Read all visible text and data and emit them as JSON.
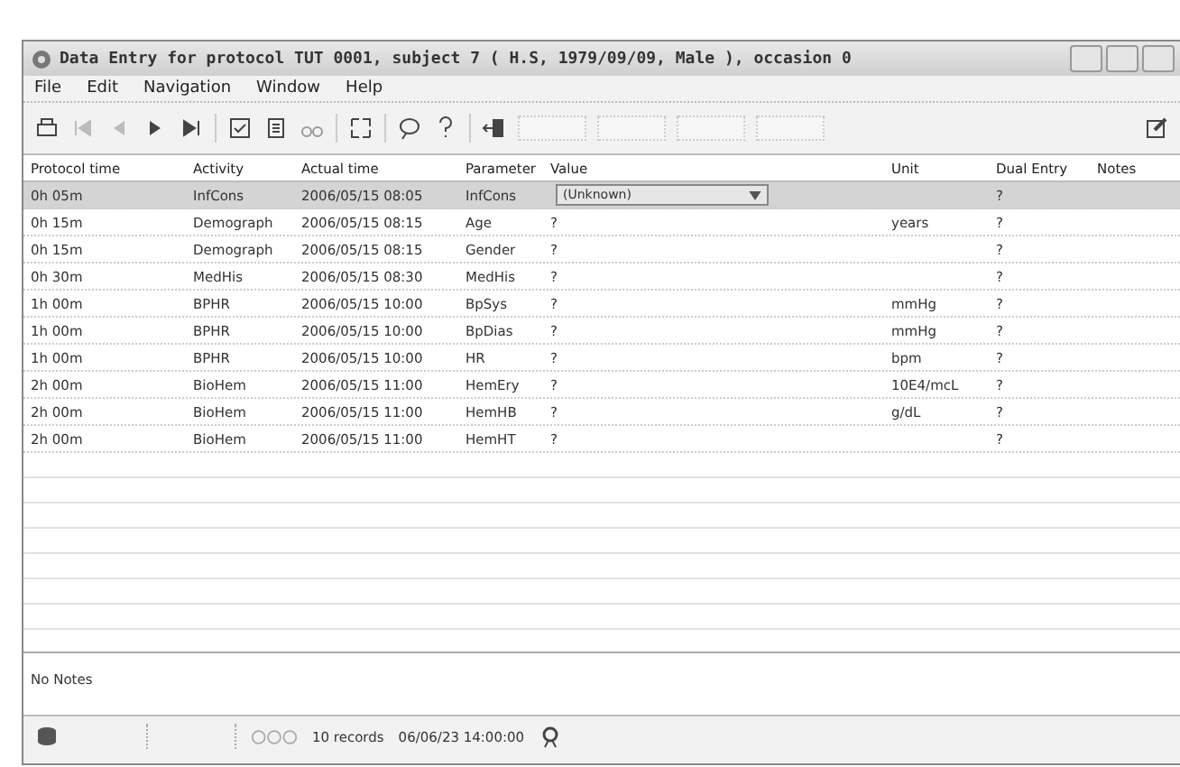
{
  "window": {
    "title": "Data Entry for protocol TUT 0001, subject 7 ( H.S, 1979/09/09, Male ), occasion 0"
  },
  "menu": [
    "File",
    "Edit",
    "Navigation",
    "Window",
    "Help"
  ],
  "table": {
    "columns": [
      "Protocol time",
      "Activity",
      "Actual time",
      "Parameter",
      "Value",
      "Unit",
      "Dual Entry",
      "Notes"
    ],
    "rows": [
      {
        "selected": true,
        "cells": [
          "0h 05m",
          "InfCons",
          "2006/05/15 08:05",
          "InfCons",
          "(Unknown)",
          "",
          "?",
          ""
        ],
        "kind": "dropdown"
      },
      {
        "selected": false,
        "cells": [
          "0h 15m",
          "Demograph",
          "2006/05/15 08:15",
          "Age",
          "?",
          "years",
          "?",
          ""
        ],
        "kind": "text"
      },
      {
        "selected": false,
        "cells": [
          "0h 15m",
          "Demograph",
          "2006/05/15 08:15",
          "Gender",
          "?",
          "",
          "?",
          ""
        ],
        "kind": "text"
      },
      {
        "selected": false,
        "cells": [
          "0h 30m",
          "MedHis",
          "2006/05/15 08:30",
          "MedHis",
          "?",
          "",
          "?",
          ""
        ],
        "kind": "text"
      },
      {
        "selected": false,
        "cells": [
          "1h 00m",
          "BPHR",
          "2006/05/15 10:00",
          "BpSys",
          "?",
          "mmHg",
          "?",
          ""
        ],
        "kind": "text"
      },
      {
        "selected": false,
        "cells": [
          "1h 00m",
          "BPHR",
          "2006/05/15 10:00",
          "BpDias",
          "?",
          "mmHg",
          "?",
          ""
        ],
        "kind": "text"
      },
      {
        "selected": false,
        "cells": [
          "1h 00m",
          "BPHR",
          "2006/05/15 10:00",
          "HR",
          "?",
          "bpm",
          "?",
          ""
        ],
        "kind": "text"
      },
      {
        "selected": false,
        "cells": [
          "2h 00m",
          "BioHem",
          "2006/05/15 11:00",
          "HemEry",
          "?",
          "10E4/mcL",
          "?",
          ""
        ],
        "kind": "text"
      },
      {
        "selected": false,
        "cells": [
          "2h 00m",
          "BioHem",
          "2006/05/15 11:00",
          "HemHB",
          "?",
          "g/dL",
          "?",
          ""
        ],
        "kind": "text"
      },
      {
        "selected": false,
        "cells": [
          "2h 00m",
          "BioHem",
          "2006/05/15 11:00",
          "HemHT",
          "?",
          "",
          "?",
          ""
        ],
        "kind": "text"
      }
    ]
  },
  "notes": {
    "text": "No Notes"
  },
  "status_bar": {
    "records": "10 records",
    "datetime": "06/06/23 14:00:00"
  }
}
